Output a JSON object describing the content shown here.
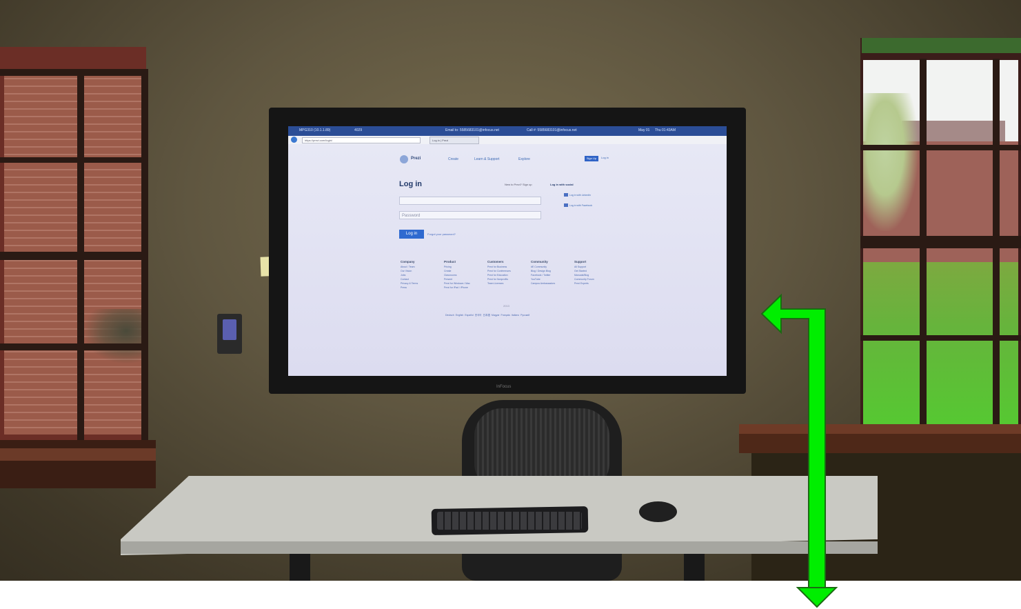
{
  "scene": {
    "description_kind": "room-photo",
    "tv_brand": "InFocus",
    "arrow_color": "#00ff00"
  },
  "screen": {
    "taskbar": {
      "device": "MPG310 (10.1.1.89)",
      "count": "4029",
      "email": "Email to: 5585683101@infocus.net",
      "call": "Call #: 5585683101@infocus.net",
      "date": "May 01",
      "time": "Thu 01:43AM"
    },
    "browser": {
      "url": "https://prezi.com/login/",
      "tab_label": "Log in | Prezi"
    },
    "prezi": {
      "logo": "Prezi",
      "nav": [
        "Create",
        "Learn & Support",
        "Explore"
      ],
      "signup": "Sign Up",
      "login_link": "Log in",
      "login_title": "Log in",
      "new_to_prezi": "New to Prezi? Sign up",
      "social_title": "Log in with social",
      "social": [
        "Log in with LinkedIn",
        "Log in with Facebook"
      ],
      "password_placeholder": "Password",
      "login_button": "Log in",
      "forgot": "Forgot your password?",
      "footer": [
        {
          "head": "Company",
          "items": [
            "About / Team",
            "Our Vision",
            "Jobs",
            "Contact",
            "Privacy & Terms",
            "Press"
          ]
        },
        {
          "head": "Product",
          "items": [
            "Pricing",
            "Create",
            "Classrooms",
            "Present",
            "Prezi for Windows / Mac",
            "Prezi for iPad / iPhone"
          ]
        },
        {
          "head": "Customers",
          "items": [
            "Prezi for Business",
            "Prezi for Conferences",
            "Prezi for Education",
            "Prezi for Nonprofits",
            "Team Licenses"
          ]
        },
        {
          "head": "Community",
          "items": [
            "#E Community",
            "Blog / Design Blog",
            "Facebook / Twitter",
            "YouTube",
            "Campus Ambassadors"
          ]
        },
        {
          "head": "Support",
          "items": [
            "All Support",
            "Get Started",
            "Manuals/Blog",
            "Community Forum",
            "Prezi Experts"
          ]
        }
      ],
      "footer_mid": "2013",
      "languages": [
        "Deutsch",
        "English",
        "Español",
        "한국어",
        "日本語",
        "Magyar",
        "Français",
        "Italiano",
        "Русский"
      ]
    }
  }
}
